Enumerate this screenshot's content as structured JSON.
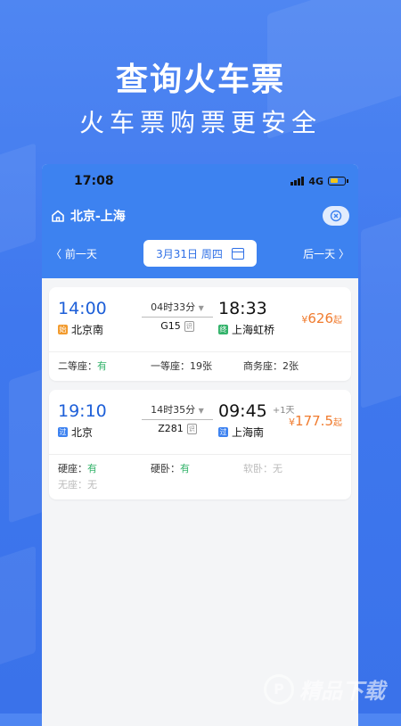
{
  "promo": {
    "title": "查询火车票",
    "subtitle": "火车票购票更安全"
  },
  "status_bar": {
    "time": "17:08",
    "network": "4G"
  },
  "header": {
    "route": "北京-上海",
    "prev_day": "〈 前一天",
    "next_day": "后一天 〉",
    "date": "3月31日 周四"
  },
  "trains": [
    {
      "dep_time": "14:00",
      "dep_station": "北京南",
      "dep_tag": "始",
      "duration": "04时33分",
      "train_no": "G15",
      "id_badge": "识",
      "arr_time": "18:33",
      "arr_station": "上海虹桥",
      "arr_tag": "终",
      "plus_day": "",
      "price_symbol": "¥",
      "price": "626",
      "price_suffix": "起",
      "seats": [
        {
          "name": "二等座：",
          "status": "有"
        },
        {
          "name": "一等座：",
          "status": "19张"
        },
        {
          "name": "商务座：",
          "status": "2张"
        }
      ]
    },
    {
      "dep_time": "19:10",
      "dep_station": "北京",
      "dep_tag": "过",
      "duration": "14时35分",
      "train_no": "Z281",
      "id_badge": "识",
      "arr_time": "09:45",
      "arr_station": "上海南",
      "arr_tag": "过",
      "plus_day": "+1天",
      "price_symbol": "¥",
      "price": "177.5",
      "price_suffix": "起",
      "seats": [
        {
          "name": "硬座：",
          "status": "有"
        },
        {
          "name": "硬卧：",
          "status": "有"
        },
        {
          "name": "软卧：",
          "status": "无"
        },
        {
          "name": "无座：",
          "status": "无"
        }
      ]
    }
  ],
  "watermark": {
    "text": "精品下载",
    "logo": "P"
  },
  "colors": {
    "primary": "#3d82f0",
    "price": "#f07b2e",
    "available": "#34b36b",
    "unavailable": "#bbbbbb"
  }
}
